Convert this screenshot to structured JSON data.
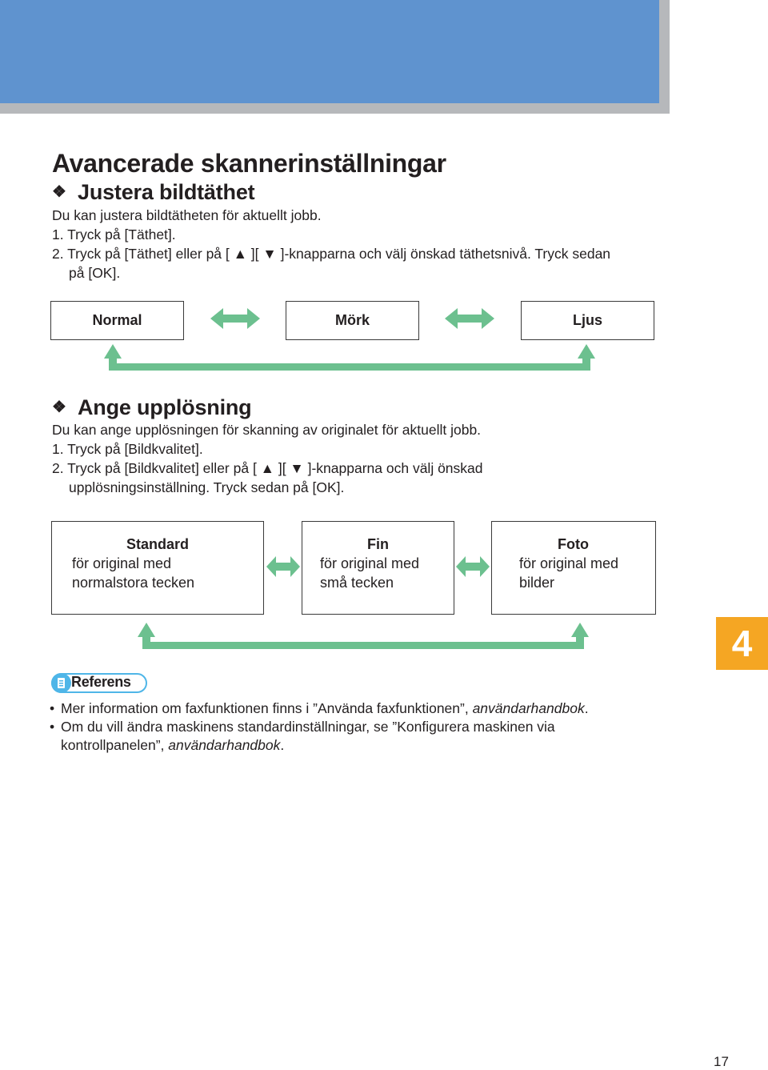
{
  "colors": {
    "header_blue": "#5f93cf",
    "arrow_green": "#6cc08f",
    "chapter_orange": "#f5a623",
    "reference_blue": "#4fb6e8"
  },
  "page_title": "Avancerade skannerinställningar",
  "section1": {
    "icon": "diamond-bullet-icon",
    "heading": "Justera bildtäthet",
    "intro": "Du kan justera bildtätheten för aktuellt jobb.",
    "step1": "1. Tryck på [Täthet].",
    "step2_line1": "2. Tryck på [Täthet] eller på [ ▲ ][ ▼ ]-knapparna och välj önskad täthetsnivå. Tryck sedan",
    "step2_line2": "på [OK].",
    "diagram": {
      "options": [
        "Normal",
        "Mörk",
        "Ljus"
      ]
    }
  },
  "section2": {
    "icon": "diamond-bullet-icon",
    "heading": "Ange upplösning",
    "intro": "Du kan ange upplösningen för skanning av originalet för aktuellt jobb.",
    "step1": "1. Tryck på [Bildkvalitet].",
    "step2_line1": "2. Tryck på [Bildkvalitet] eller på [ ▲ ][ ▼ ]-knapparna och välj önskad",
    "step2_line2": "upplösningsinställning. Tryck sedan på [OK].",
    "diagram": {
      "options": [
        {
          "title": "Standard",
          "line1": "för original med",
          "line2": "normalstora tecken"
        },
        {
          "title": "Fin",
          "line1": "för original med",
          "line2": "små tecken"
        },
        {
          "title": "Foto",
          "line1": "för original med",
          "line2": "bilder"
        }
      ]
    }
  },
  "reference": {
    "label": "Referens",
    "items": [
      {
        "text": "Mer information om faxfunktionen finns i ”Använda faxfunktionen”, ",
        "italic": "användarhandbok",
        "end": "."
      },
      {
        "text": "Om du vill ändra maskinens standardinställningar, se ”Konfigurera maskinen via kontrollpanelen”, ",
        "italic": "användarhandbok",
        "end": "."
      }
    ]
  },
  "chapter_number": "4",
  "page_number": "17"
}
